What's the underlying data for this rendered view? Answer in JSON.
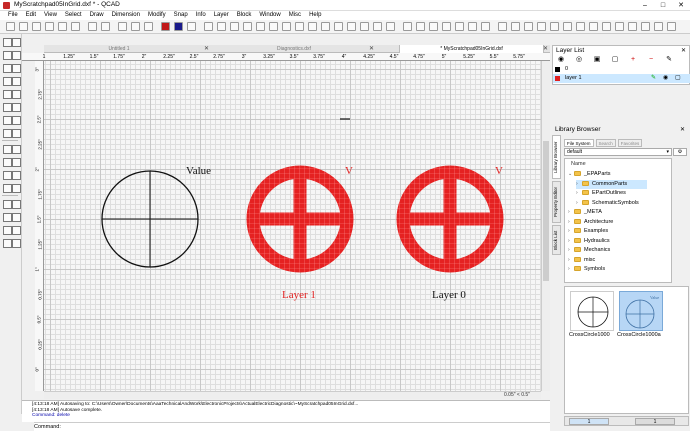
{
  "window": {
    "title": "MyScratchpad05InGrid.dxf * - QCAD"
  },
  "menu": [
    "File",
    "Edit",
    "View",
    "Select",
    "Draw",
    "Dimension",
    "Modify",
    "Snap",
    "Info",
    "Layer",
    "Block",
    "Window",
    "Misc",
    "Help"
  ],
  "tabs": [
    {
      "label": "Untitled 1",
      "active": false
    },
    {
      "label": "Diagnostics.dxf",
      "active": false
    },
    {
      "label": "* MyScratchpad05InGrid.dxf",
      "active": true
    }
  ],
  "ruler": {
    "h_labels": [
      "1",
      "1.25\"",
      "1.5\"",
      "1.75\"",
      "2\"",
      "2.25\"",
      "2.5\"",
      "2.75\"",
      "3\"",
      "3.25\"",
      "3.5\"",
      "3.75\"",
      "4\"",
      "4.25\"",
      "4.5\"",
      "4.75\"",
      "5\"",
      "5.25\"",
      "5.5\"",
      "5.75\""
    ],
    "v_labels": [
      "3\"",
      "2.75\"",
      "2.5\"",
      "2.25\"",
      "2\"",
      "1.75\"",
      "1.5\"",
      "1.25\"",
      "1\"",
      "0.75\"",
      "0.5\"",
      "0.25\"",
      "0\""
    ]
  },
  "drawing": {
    "text_value": "Value",
    "text_v1": "V",
    "text_v2": "V",
    "text_layer1": "Layer 1",
    "text_layer0": "Layer 0",
    "color_black_circle": "#111111",
    "color_red": "#e02020"
  },
  "status": {
    "coords": "0.05\" < 0.5\""
  },
  "console": {
    "line1": "[4:13:18 AM] Autosaving to: C:\\Users\\Owner\\Documents\\AaaTechnicalAndWork\\ElectronicProjects\\ActualElectricDiagnostic\\~MyScratchpad05InGrid.dxf...",
    "line2": "[4:13:18 AM] Autosave complete.",
    "line3": "Command: delete"
  },
  "command": {
    "label": "Command:"
  },
  "layer_list": {
    "title": "Layer List",
    "layers": [
      {
        "name": "0",
        "selected": false
      },
      {
        "name": "layer 1",
        "selected": true
      }
    ]
  },
  "library": {
    "title": "Library Browser",
    "side_tabs": [
      "Library Browser",
      "Property Editor",
      "Block List"
    ],
    "file_tabs": [
      "File System",
      "Search",
      "Favorites"
    ],
    "source": "default",
    "column": "Name",
    "tree": [
      {
        "label": "_EPAParts",
        "level": 0,
        "expanded": true
      },
      {
        "label": "CommonParts",
        "level": 1,
        "expanded": false,
        "selected": true
      },
      {
        "label": "EPartOutlines",
        "level": 1,
        "expanded": false
      },
      {
        "label": "SchematicSymbols",
        "level": 1,
        "expanded": false
      },
      {
        "label": "_META",
        "level": 0,
        "expanded": false
      },
      {
        "label": "Architecture",
        "level": 0,
        "expanded": false
      },
      {
        "label": "Examples",
        "level": 0,
        "expanded": false
      },
      {
        "label": "Hydraulics",
        "level": 0,
        "expanded": false
      },
      {
        "label": "Mechanics",
        "level": 0,
        "expanded": false
      },
      {
        "label": "misc",
        "level": 0,
        "expanded": false
      },
      {
        "label": "Symbols",
        "level": 0,
        "expanded": false
      }
    ],
    "items": [
      {
        "label": "CrossCircle1000"
      },
      {
        "label": "CrossCircle1000a",
        "thumb_text": "Value"
      }
    ],
    "pages": [
      "1",
      "1"
    ]
  }
}
